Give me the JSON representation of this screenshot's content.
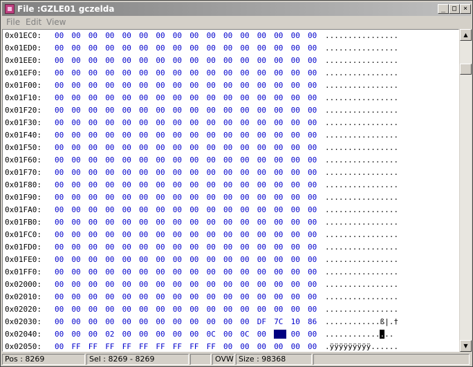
{
  "window": {
    "title": "File :GZLE01 gczelda",
    "minimize": "_",
    "maximize": "□",
    "close": "×"
  },
  "menu": [
    {
      "label": "File"
    },
    {
      "label": "Edit"
    },
    {
      "label": "View"
    }
  ],
  "rows": [
    {
      "addr": "0x01EC0:",
      "bytes": [
        "00",
        "00",
        "00",
        "00",
        "00",
        "00",
        "00",
        "00",
        "00",
        "00",
        "00",
        "00",
        "00",
        "00",
        "00",
        "00"
      ],
      "ascii": "................"
    },
    {
      "addr": "0x01ED0:",
      "bytes": [
        "00",
        "00",
        "00",
        "00",
        "00",
        "00",
        "00",
        "00",
        "00",
        "00",
        "00",
        "00",
        "00",
        "00",
        "00",
        "00"
      ],
      "ascii": "................"
    },
    {
      "addr": "0x01EE0:",
      "bytes": [
        "00",
        "00",
        "00",
        "00",
        "00",
        "00",
        "00",
        "00",
        "00",
        "00",
        "00",
        "00",
        "00",
        "00",
        "00",
        "00"
      ],
      "ascii": "................"
    },
    {
      "addr": "0x01EF0:",
      "bytes": [
        "00",
        "00",
        "00",
        "00",
        "00",
        "00",
        "00",
        "00",
        "00",
        "00",
        "00",
        "00",
        "00",
        "00",
        "00",
        "00"
      ],
      "ascii": "................"
    },
    {
      "addr": "0x01F00:",
      "bytes": [
        "00",
        "00",
        "00",
        "00",
        "00",
        "00",
        "00",
        "00",
        "00",
        "00",
        "00",
        "00",
        "00",
        "00",
        "00",
        "00"
      ],
      "ascii": "................"
    },
    {
      "addr": "0x01F10:",
      "bytes": [
        "00",
        "00",
        "00",
        "00",
        "00",
        "00",
        "00",
        "00",
        "00",
        "00",
        "00",
        "00",
        "00",
        "00",
        "00",
        "00"
      ],
      "ascii": "................"
    },
    {
      "addr": "0x01F20:",
      "bytes": [
        "00",
        "00",
        "00",
        "00",
        "00",
        "00",
        "00",
        "00",
        "00",
        "00",
        "00",
        "00",
        "00",
        "00",
        "00",
        "00"
      ],
      "ascii": "................"
    },
    {
      "addr": "0x01F30:",
      "bytes": [
        "00",
        "00",
        "00",
        "00",
        "00",
        "00",
        "00",
        "00",
        "00",
        "00",
        "00",
        "00",
        "00",
        "00",
        "00",
        "00"
      ],
      "ascii": "................"
    },
    {
      "addr": "0x01F40:",
      "bytes": [
        "00",
        "00",
        "00",
        "00",
        "00",
        "00",
        "00",
        "00",
        "00",
        "00",
        "00",
        "00",
        "00",
        "00",
        "00",
        "00"
      ],
      "ascii": "................"
    },
    {
      "addr": "0x01F50:",
      "bytes": [
        "00",
        "00",
        "00",
        "00",
        "00",
        "00",
        "00",
        "00",
        "00",
        "00",
        "00",
        "00",
        "00",
        "00",
        "00",
        "00"
      ],
      "ascii": "................"
    },
    {
      "addr": "0x01F60:",
      "bytes": [
        "00",
        "00",
        "00",
        "00",
        "00",
        "00",
        "00",
        "00",
        "00",
        "00",
        "00",
        "00",
        "00",
        "00",
        "00",
        "00"
      ],
      "ascii": "................"
    },
    {
      "addr": "0x01F70:",
      "bytes": [
        "00",
        "00",
        "00",
        "00",
        "00",
        "00",
        "00",
        "00",
        "00",
        "00",
        "00",
        "00",
        "00",
        "00",
        "00",
        "00"
      ],
      "ascii": "................"
    },
    {
      "addr": "0x01F80:",
      "bytes": [
        "00",
        "00",
        "00",
        "00",
        "00",
        "00",
        "00",
        "00",
        "00",
        "00",
        "00",
        "00",
        "00",
        "00",
        "00",
        "00"
      ],
      "ascii": "................"
    },
    {
      "addr": "0x01F90:",
      "bytes": [
        "00",
        "00",
        "00",
        "00",
        "00",
        "00",
        "00",
        "00",
        "00",
        "00",
        "00",
        "00",
        "00",
        "00",
        "00",
        "00"
      ],
      "ascii": "................"
    },
    {
      "addr": "0x01FA0:",
      "bytes": [
        "00",
        "00",
        "00",
        "00",
        "00",
        "00",
        "00",
        "00",
        "00",
        "00",
        "00",
        "00",
        "00",
        "00",
        "00",
        "00"
      ],
      "ascii": "................"
    },
    {
      "addr": "0x01FB0:",
      "bytes": [
        "00",
        "00",
        "00",
        "00",
        "00",
        "00",
        "00",
        "00",
        "00",
        "00",
        "00",
        "00",
        "00",
        "00",
        "00",
        "00"
      ],
      "ascii": "................"
    },
    {
      "addr": "0x01FC0:",
      "bytes": [
        "00",
        "00",
        "00",
        "00",
        "00",
        "00",
        "00",
        "00",
        "00",
        "00",
        "00",
        "00",
        "00",
        "00",
        "00",
        "00"
      ],
      "ascii": "................"
    },
    {
      "addr": "0x01FD0:",
      "bytes": [
        "00",
        "00",
        "00",
        "00",
        "00",
        "00",
        "00",
        "00",
        "00",
        "00",
        "00",
        "00",
        "00",
        "00",
        "00",
        "00"
      ],
      "ascii": "................"
    },
    {
      "addr": "0x01FE0:",
      "bytes": [
        "00",
        "00",
        "00",
        "00",
        "00",
        "00",
        "00",
        "00",
        "00",
        "00",
        "00",
        "00",
        "00",
        "00",
        "00",
        "00"
      ],
      "ascii": "................"
    },
    {
      "addr": "0x01FF0:",
      "bytes": [
        "00",
        "00",
        "00",
        "00",
        "00",
        "00",
        "00",
        "00",
        "00",
        "00",
        "00",
        "00",
        "00",
        "00",
        "00",
        "00"
      ],
      "ascii": "................"
    },
    {
      "addr": "0x02000:",
      "bytes": [
        "00",
        "00",
        "00",
        "00",
        "00",
        "00",
        "00",
        "00",
        "00",
        "00",
        "00",
        "00",
        "00",
        "00",
        "00",
        "00"
      ],
      "ascii": "................"
    },
    {
      "addr": "0x02010:",
      "bytes": [
        "00",
        "00",
        "00",
        "00",
        "00",
        "00",
        "00",
        "00",
        "00",
        "00",
        "00",
        "00",
        "00",
        "00",
        "00",
        "00"
      ],
      "ascii": "................"
    },
    {
      "addr": "0x02020:",
      "bytes": [
        "00",
        "00",
        "00",
        "00",
        "00",
        "00",
        "00",
        "00",
        "00",
        "00",
        "00",
        "00",
        "00",
        "00",
        "00",
        "00"
      ],
      "ascii": "................"
    },
    {
      "addr": "0x02030:",
      "bytes": [
        "00",
        "00",
        "00",
        "00",
        "00",
        "00",
        "00",
        "00",
        "00",
        "00",
        "00",
        "00",
        "DF",
        "7C",
        "10",
        "86"
      ],
      "ascii": "............ß|.†"
    },
    {
      "addr": "0x02040:",
      "bytes": [
        "00",
        "00",
        "00",
        "02",
        "00",
        "00",
        "00",
        "00",
        "00",
        "0C",
        "00",
        "0C",
        "00",
        "00",
        "00",
        "00"
      ],
      "ascii": "............",
      "cursor": ".",
      "ascii_tail": "..",
      "selected": 13
    },
    {
      "addr": "0x02050:",
      "bytes": [
        "00",
        "FF",
        "FF",
        "FF",
        "FF",
        "FF",
        "FF",
        "FF",
        "FF",
        "FF",
        "00",
        "00",
        "00",
        "00",
        "00",
        "00"
      ],
      "ascii": ".ÿÿÿÿÿÿÿÿÿ......"
    }
  ],
  "status": {
    "pos": "Pos : 8269",
    "sel": "Sel : 8269 - 8269",
    "mode": "OVW",
    "size": "Size : 98368"
  },
  "scroll": {
    "up": "▲",
    "down": "▼"
  }
}
